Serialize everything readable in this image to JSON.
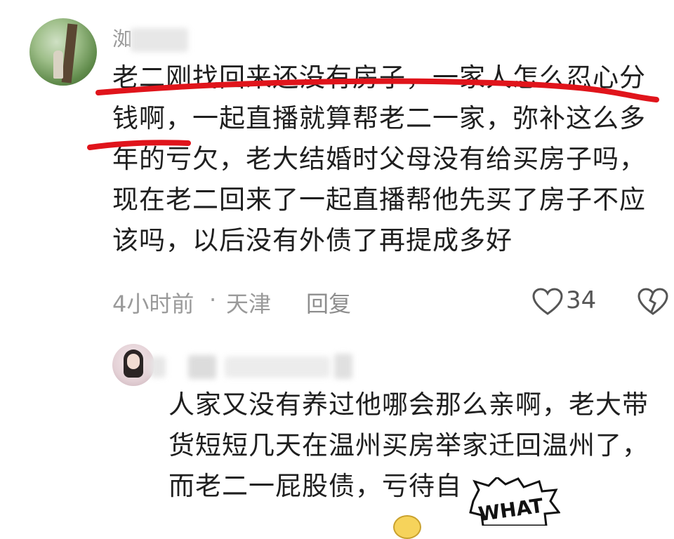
{
  "comments": [
    {
      "username": "洳",
      "text_lines": [
        "老二刚找回来还没有房子，一家人怎么忍心分",
        "钱啊，一起直播就算帮老二一家，弥补这么多",
        "年的亏欠，老大结婚时父母没有给买房子吗，",
        "现在老二回来了一起直播帮他先买了房子不应",
        "该吗，以后没有外债了再提成多好"
      ],
      "time": "4小时前",
      "separator": "·",
      "location": "天津",
      "reply_label": "回复",
      "likes": "34"
    },
    {
      "username": "",
      "text_lines": [
        "人家又没有养过他哪会那么亲啊，老大带",
        "货短短几天在温州买房举家迁回温州了，",
        "而老二一屁股债，亏待自"
      ]
    }
  ],
  "stickers": {
    "what_text": "WHAT"
  },
  "icons": {
    "like": "heart-outline-icon",
    "dislike": "broken-heart-icon"
  },
  "colors": {
    "underline": "#e0141b",
    "meta": "#9a9a9a"
  }
}
